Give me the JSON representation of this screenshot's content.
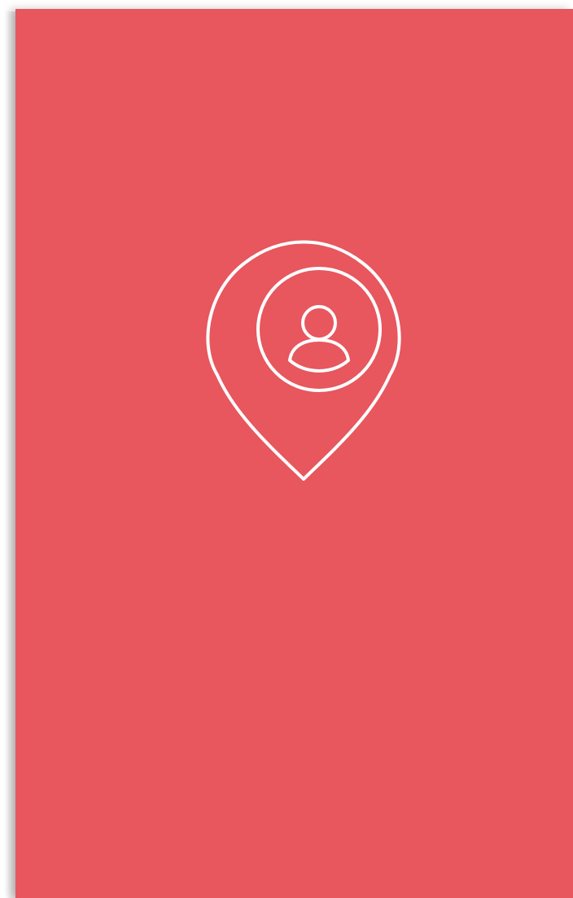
{
  "screen": {
    "background_color": "#e8565e",
    "icon_color": "#ffffff"
  },
  "logo": {
    "icon": "location-pin-user-icon"
  }
}
